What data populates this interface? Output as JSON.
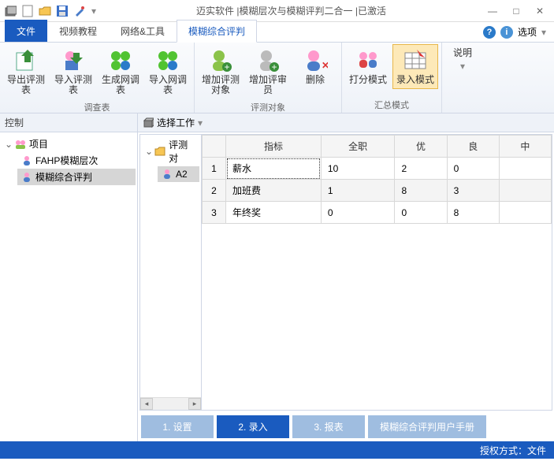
{
  "title": "迈实软件 |模糊层次与模糊评判二合一 |已激活",
  "tabs": {
    "file": "文件",
    "items": [
      "视频教程",
      "网络&工具",
      "模糊综合评判"
    ],
    "activeIndex": 2,
    "options": "选项"
  },
  "ribbon": {
    "groups": [
      {
        "label": "调查表",
        "items": [
          {
            "label": "导出评测表",
            "icon": "export"
          },
          {
            "label": "导入评测表",
            "icon": "import"
          },
          {
            "label": "生成网调表",
            "icon": "genweb"
          },
          {
            "label": "导入网调表",
            "icon": "impweb"
          }
        ]
      },
      {
        "label": "评测对象",
        "items": [
          {
            "label": "增加评测对象",
            "icon": "addobj"
          },
          {
            "label": "增加评审员",
            "icon": "addrev"
          },
          {
            "label": "删除",
            "icon": "delete"
          }
        ]
      },
      {
        "label": "汇总模式",
        "items": [
          {
            "label": "打分模式",
            "icon": "score"
          },
          {
            "label": "录入模式",
            "icon": "input",
            "selected": true
          }
        ]
      }
    ],
    "help": "说明"
  },
  "control": {
    "title": "控制",
    "root": "项目",
    "children": [
      {
        "label": "FAHP模糊层次"
      },
      {
        "label": "模糊综合评判",
        "selected": true
      }
    ]
  },
  "select": {
    "title": "选择工作"
  },
  "sideTree": {
    "root": "评测对",
    "child": "A2"
  },
  "grid": {
    "headers": [
      "指标",
      "全职",
      "优",
      "良",
      "中"
    ],
    "rows": [
      {
        "idx": 1,
        "cells": [
          "薪水",
          "10",
          "2",
          "0"
        ],
        "current": true
      },
      {
        "idx": 2,
        "cells": [
          "加班费",
          "1",
          "8",
          "3"
        ]
      },
      {
        "idx": 3,
        "cells": [
          "年终奖",
          "0",
          "0",
          "8"
        ]
      }
    ]
  },
  "bottom": {
    "b1": "1. 设置",
    "b2": "2. 录入",
    "b3": "3. 报表",
    "b4": "模糊综合评判用户手册"
  },
  "status": "授权方式：文件"
}
